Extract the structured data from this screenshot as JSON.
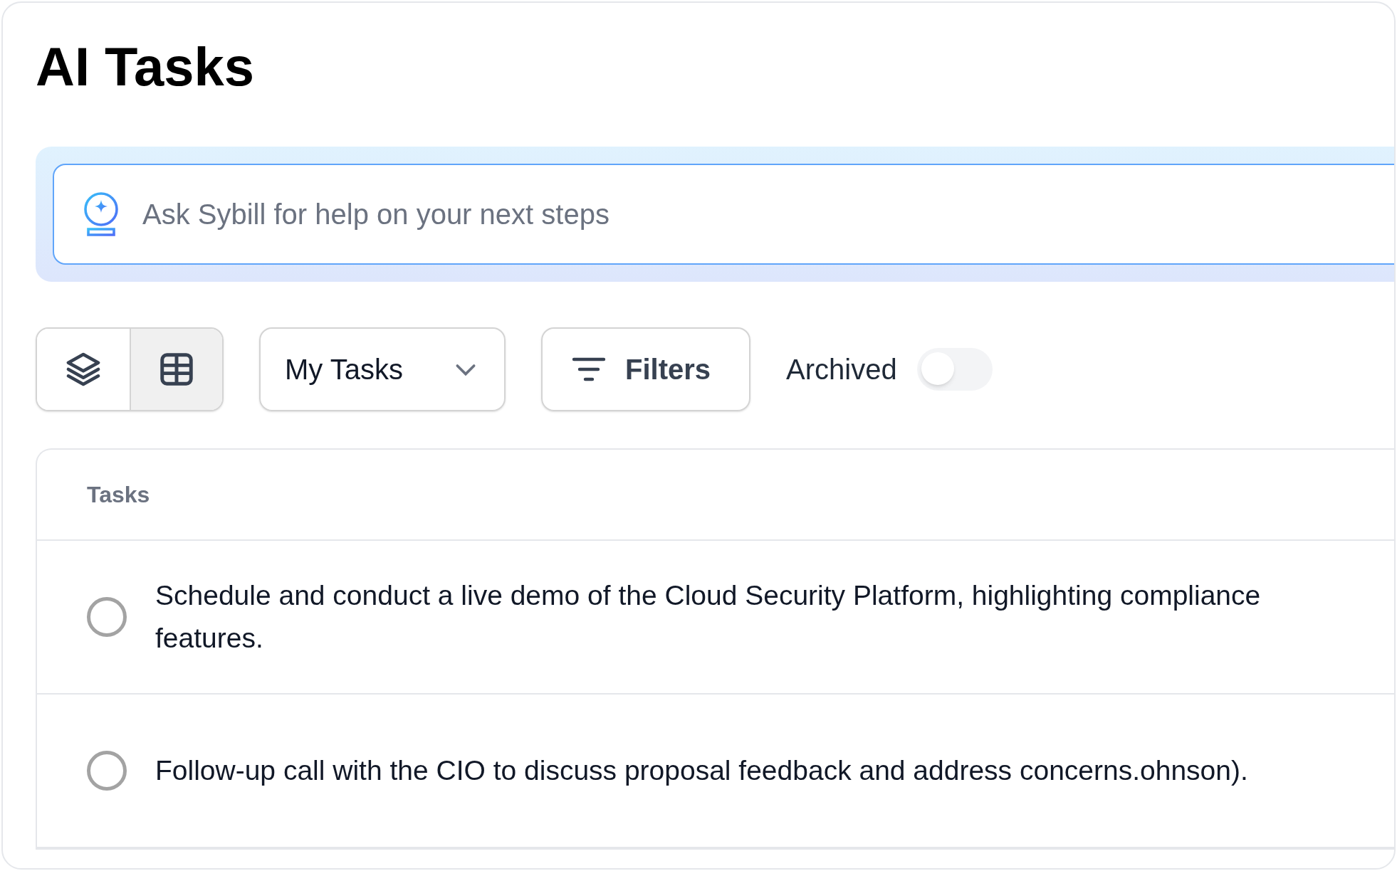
{
  "title": "AI Tasks",
  "ask": {
    "placeholder": "Ask Sybill for help on your next steps"
  },
  "views": [
    {
      "kind": "stack",
      "selected": false
    },
    {
      "kind": "grid",
      "selected": true
    }
  ],
  "scope": {
    "value": "My Tasks"
  },
  "filters": {
    "label": "Filters"
  },
  "archived": {
    "label": "Archived",
    "on": false
  },
  "table": {
    "column": "Tasks",
    "rows": [
      {
        "text": "Schedule and conduct a live demo of the Cloud Security Platform, highlighting compliance features.",
        "done": false
      },
      {
        "text": "Follow-up call with the CIO to discuss proposal feedback and address concerns.ohnson).",
        "done": false
      }
    ]
  }
}
